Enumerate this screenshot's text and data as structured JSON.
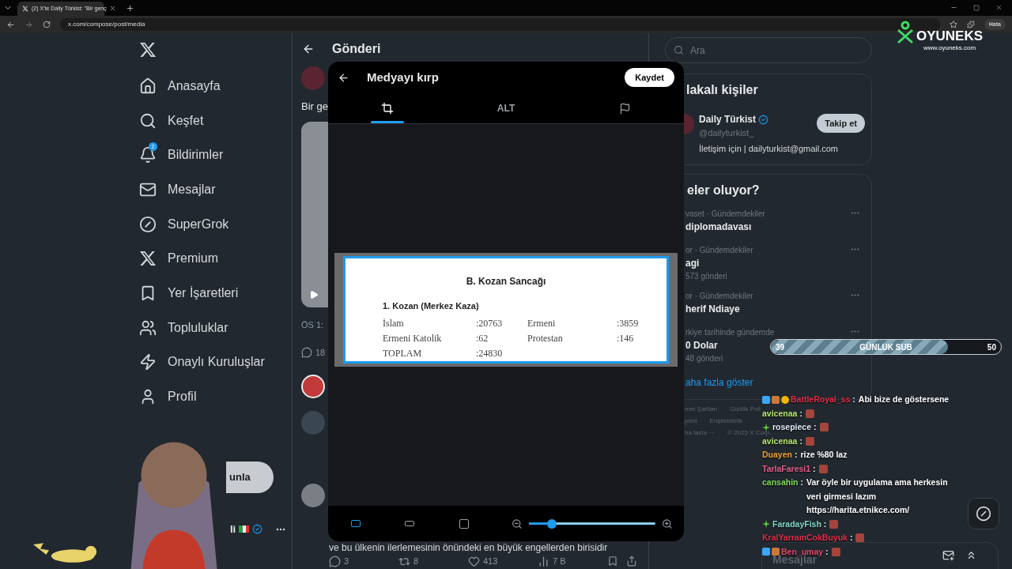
{
  "browser": {
    "tab_title": "(2) X'te Daily Türkist: \"Bir genç",
    "url": "x.com/compose/post/media",
    "profile_label": "Hata"
  },
  "nav": {
    "items": [
      {
        "kind": "home",
        "label": "Anasayfa"
      },
      {
        "kind": "search",
        "label": "Keşfet"
      },
      {
        "kind": "bell",
        "label": "Bildirimler",
        "badge": "2"
      },
      {
        "kind": "mail",
        "label": "Mesajlar"
      },
      {
        "kind": "grok",
        "label": "SuperGrok"
      },
      {
        "kind": "x",
        "label": "Premium"
      },
      {
        "kind": "bookmark",
        "label": "Yer İşaretleri"
      },
      {
        "kind": "people",
        "label": "Topluluklar"
      },
      {
        "kind": "bolt",
        "label": "Onaylı Kuruluşlar"
      },
      {
        "kind": "person",
        "label": "Profil"
      }
    ],
    "post_button_fragment": "unla",
    "account_fragment": "li"
  },
  "center": {
    "title": "Gönderi",
    "post_text_fragment": "Bir ge",
    "time_fragment": "ÖS 1:",
    "reply_count_fragment": "18",
    "reply_text": "ve bu ülkenin ilerlemesinin önündeki en büyük engellerden birisidir",
    "actions": [
      {
        "kind": "reply",
        "count": "3"
      },
      {
        "kind": "repost",
        "count": "8"
      },
      {
        "kind": "like",
        "count": "413"
      },
      {
        "kind": "views",
        "count": "7 B"
      }
    ]
  },
  "modal": {
    "title": "Medyayı kırp",
    "save_label": "Kaydet",
    "tabs": [
      {
        "kind": "crop",
        "selected": true
      },
      {
        "kind": "text",
        "label": "ALT",
        "selected": false
      },
      {
        "kind": "flag",
        "selected": false
      }
    ],
    "document": {
      "title": "B. Kozan Sancağı",
      "subtitle": "1. Kozan (Merkez Kaza)",
      "rows": [
        [
          "İslam",
          ":20763",
          "Ermeni",
          ":3859"
        ],
        [
          "Ermeni Katolik",
          ":62",
          "Protestan",
          ":146"
        ],
        [
          "TOPLAM",
          ":24830",
          "",
          ""
        ]
      ]
    },
    "aspect_options": [
      {
        "kind": "original",
        "selected": true
      },
      {
        "kind": "wide",
        "selected": false
      },
      {
        "kind": "square",
        "selected": false
      }
    ],
    "zoom": {
      "level": 0.18
    }
  },
  "right": {
    "search_placeholder": "Ara",
    "people": {
      "title_fragment": "lakalı kişiler",
      "name": "Daily Türkist",
      "verified": true,
      "handle": "@dailyturkist_",
      "bio": "İletişim için | dailyturkist@gmail.com",
      "follow_label": "Takip et"
    },
    "trends": {
      "title_fragment": "eler oluyor?",
      "items": [
        {
          "context": "vaset · Gündemdekiler",
          "name": "diplomadavası"
        },
        {
          "context": "or · Gündemdekiler",
          "name": "agi",
          "count": "573 gönderi"
        },
        {
          "context": "or · Gündemdekiler",
          "name": "herif Ndiaye"
        },
        {
          "context": "rkiye tarihinde gündemde",
          "name": "0 Dolar",
          "count": "48 gönderi"
        }
      ],
      "show_more": "aha fazla göster"
    },
    "footer": [
      [
        "met Şartları",
        "Gizlilik Poli"
      ],
      [
        "print",
        "Erişilebilirlik"
      ],
      [
        "ha fazla ···",
        "© 2025 X Corp."
      ]
    ]
  },
  "overlay": {
    "logo": {
      "name": "OYUNEKS",
      "url": "www.oyuneks.com"
    },
    "sub_goal": {
      "current": "39",
      "label": "GÜNLUK SUB",
      "target": "50",
      "level": 0.77
    },
    "chat": [
      {
        "user": "BattleRoyal_ss",
        "color": "#e0304a",
        "badges": [
          {
            "kind": "cube"
          },
          {
            "kind": "gift"
          },
          {
            "kind": "coin"
          }
        ],
        "separator": ":",
        "kind": "text",
        "message": "Abi bize de göstersene"
      },
      {
        "user": "avicenaa",
        "color": "#b5e56a",
        "separator": ":",
        "kind": "emote"
      },
      {
        "user": "rosepiece",
        "color": "#dce6f5",
        "badges": [
          {
            "kind": "sparkle"
          }
        ],
        "separator": ":",
        "kind": "emote"
      },
      {
        "user": "avicenaa",
        "color": "#b5e56a",
        "separator": ":",
        "kind": "emote"
      },
      {
        "user": "Duayen",
        "color": "#f0a030",
        "separator": ":",
        "kind": "text",
        "message": "rize %80 laz"
      },
      {
        "user": "TarlaFaresi1",
        "color": "#e0608a",
        "separator": ":",
        "kind": "emote"
      },
      {
        "user": "cansahin",
        "color": "#7ed957",
        "separator": ":",
        "kind": "text",
        "message": "Var öyle bir uygulama ama herkesin veri girmesi lazım https://harita.etnikce.com/"
      },
      {
        "user": "FaradayFish",
        "color": "#7fd8c8",
        "badges": [
          {
            "kind": "sparkle"
          }
        ],
        "separator": ":",
        "kind": "emote"
      },
      {
        "user": "KralYarramCokBuyuk",
        "color": "#e0304a",
        "separator": ":",
        "kind": "emote"
      },
      {
        "user": "Ben_umay",
        "color": "#e04a6a",
        "badges": [
          {
            "kind": "cube"
          },
          {
            "kind": "gift"
          }
        ],
        "separator": ":",
        "kind": "emote"
      }
    ],
    "drawer_title": "Mesajlar"
  }
}
